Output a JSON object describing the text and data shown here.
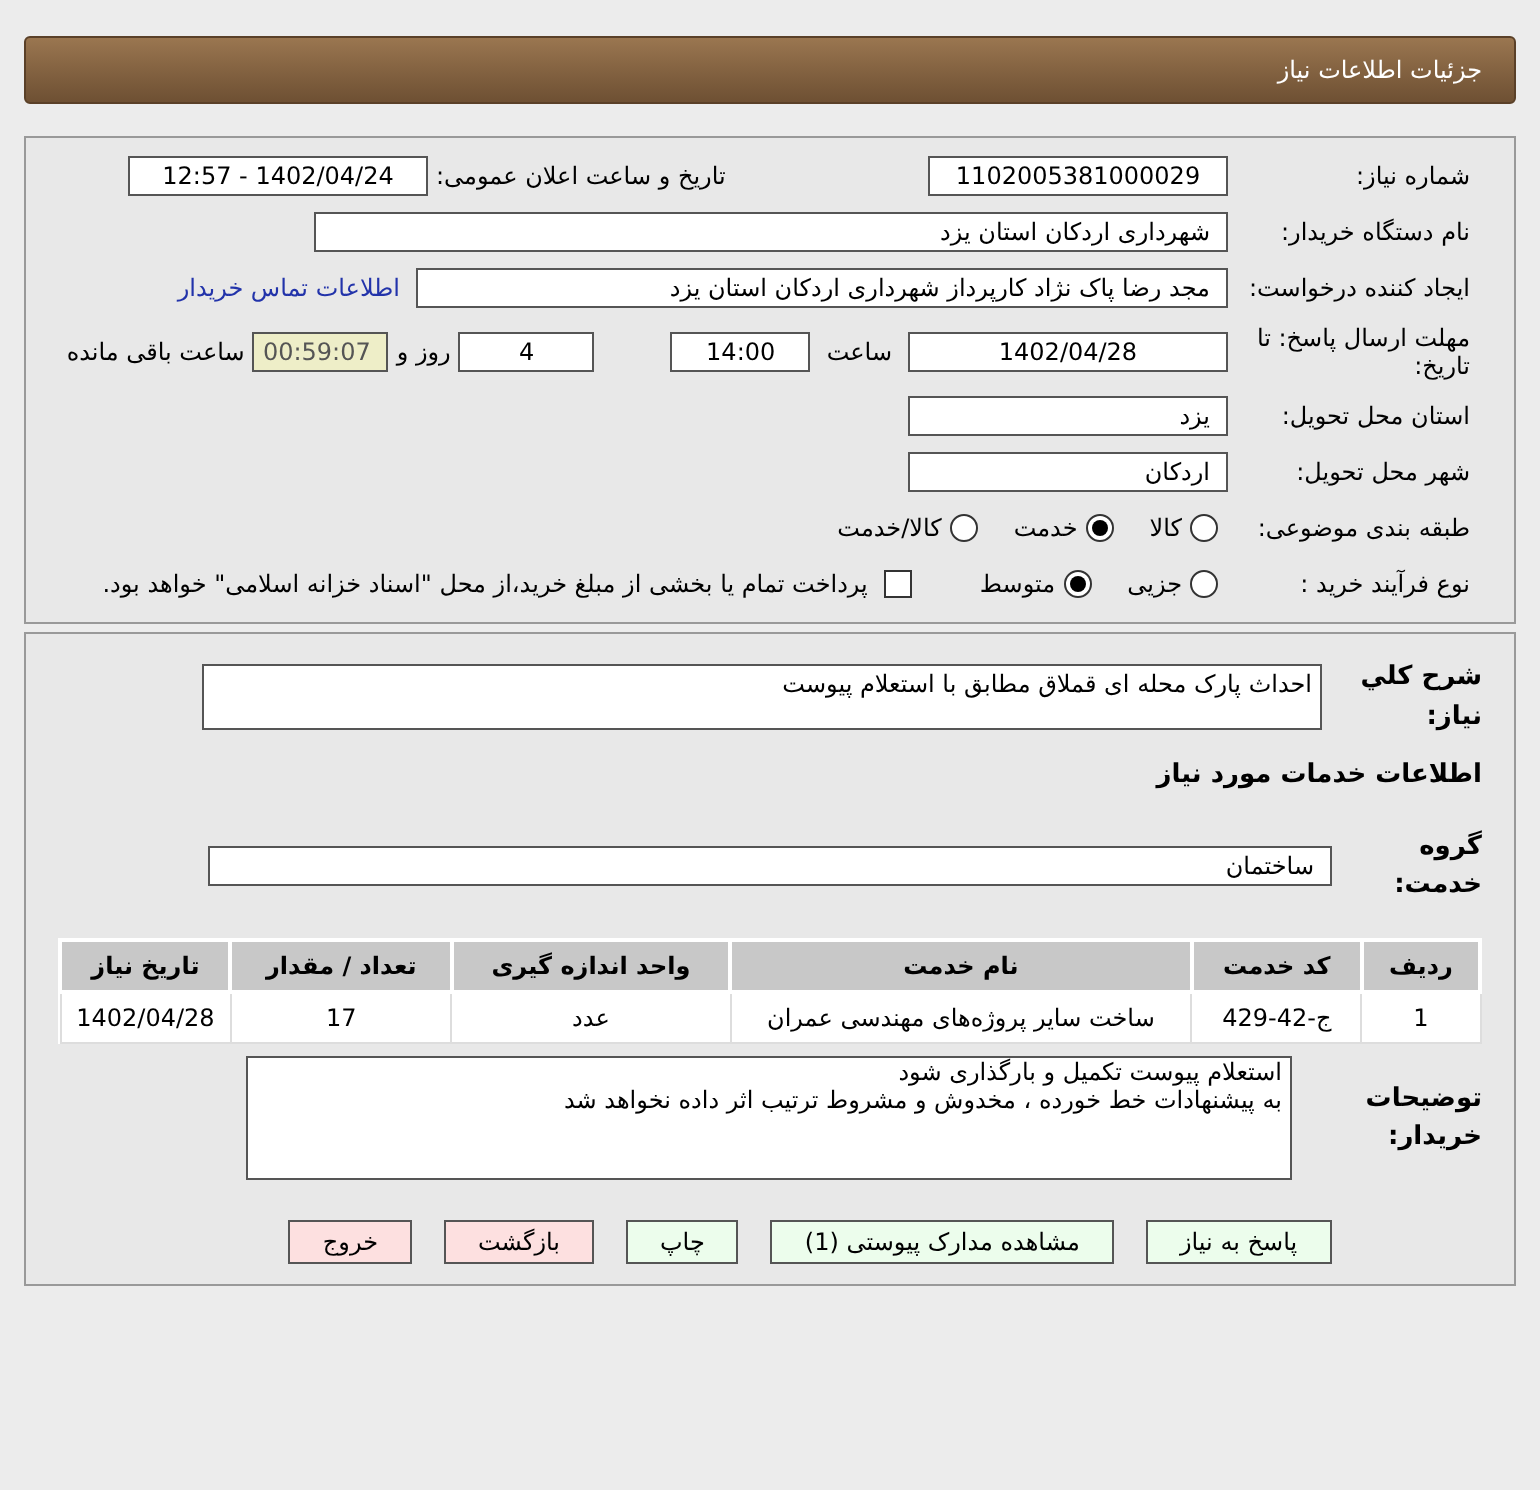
{
  "header": {
    "title": "جزئیات اطلاعات نیاز"
  },
  "need_number": {
    "label": "شماره نیاز:",
    "value": "1102005381000029"
  },
  "announce": {
    "label": "تاریخ و ساعت اعلان عمومی:",
    "value": "1402/04/24 - 12:57"
  },
  "buyer_org": {
    "label": "نام دستگاه خریدار:",
    "value": "شهرداری اردکان استان یزد"
  },
  "requester": {
    "label": "ایجاد کننده درخواست:",
    "value": "مجد رضا  پاک نژاد کارپرداز شهرداری اردکان استان یزد",
    "link": "اطلاعات تماس خریدار"
  },
  "deadline": {
    "label": "مهلت ارسال پاسخ: تا تاریخ:",
    "date": "1402/04/28",
    "time_label": "ساعت",
    "time": "14:00",
    "days": "4",
    "days_label": "روز و",
    "remaining": "00:59:07",
    "remaining_label": "ساعت باقی مانده"
  },
  "province": {
    "label": "استان محل تحویل:",
    "value": "یزد"
  },
  "city": {
    "label": "شهر محل تحویل:",
    "value": "اردکان"
  },
  "category": {
    "label": "طبقه بندی موضوعی:",
    "options": [
      {
        "label": "کالا",
        "selected": false
      },
      {
        "label": "خدمت",
        "selected": true
      },
      {
        "label": "کالا/خدمت",
        "selected": false
      }
    ]
  },
  "process": {
    "label": "نوع فرآیند خرید :",
    "options": [
      {
        "label": "جزیی",
        "selected": false
      },
      {
        "label": "متوسط",
        "selected": true
      }
    ],
    "checkbox": {
      "label": "پرداخت تمام یا بخشی از مبلغ خرید،از محل \"اسناد خزانه اسلامی\" خواهد بود.",
      "checked": false
    }
  },
  "summary": {
    "label": "شرح کلي نياز:",
    "value": "احداث پارک محله ای قملاق مطابق با استعلام پیوست"
  },
  "services_title": "اطلاعات خدمات مورد نياز",
  "service_group": {
    "label": "گروه خدمت:",
    "value": "ساختمان"
  },
  "table": {
    "columns": [
      "ردیف",
      "کد خدمت",
      "نام خدمت",
      "واحد اندازه گیری",
      "تعداد / مقدار",
      "تاریخ نیاز"
    ],
    "rows": [
      [
        "1",
        "ج-42-429",
        "ساخت سایر پروژه‌های مهندسی عمران",
        "عدد",
        "17",
        "1402/04/28"
      ]
    ]
  },
  "buyer_notes": {
    "label": "توضیحات خریدار:",
    "lines": [
      "استعلام پیوست تکمیل و بارگذاری شود",
      "به پیشنهادات خط خورده ، مخدوش و مشروط ترتیب اثر داده نخواهد شد"
    ]
  },
  "buttons": [
    {
      "label": "پاسخ به نیاز",
      "kind": "normal"
    },
    {
      "label": "مشاهده مدارک پیوستی (1)",
      "kind": "normal"
    },
    {
      "label": "چاپ",
      "kind": "normal"
    },
    {
      "label": "بازگشت",
      "kind": "danger"
    },
    {
      "label": "خروج",
      "kind": "danger"
    }
  ]
}
